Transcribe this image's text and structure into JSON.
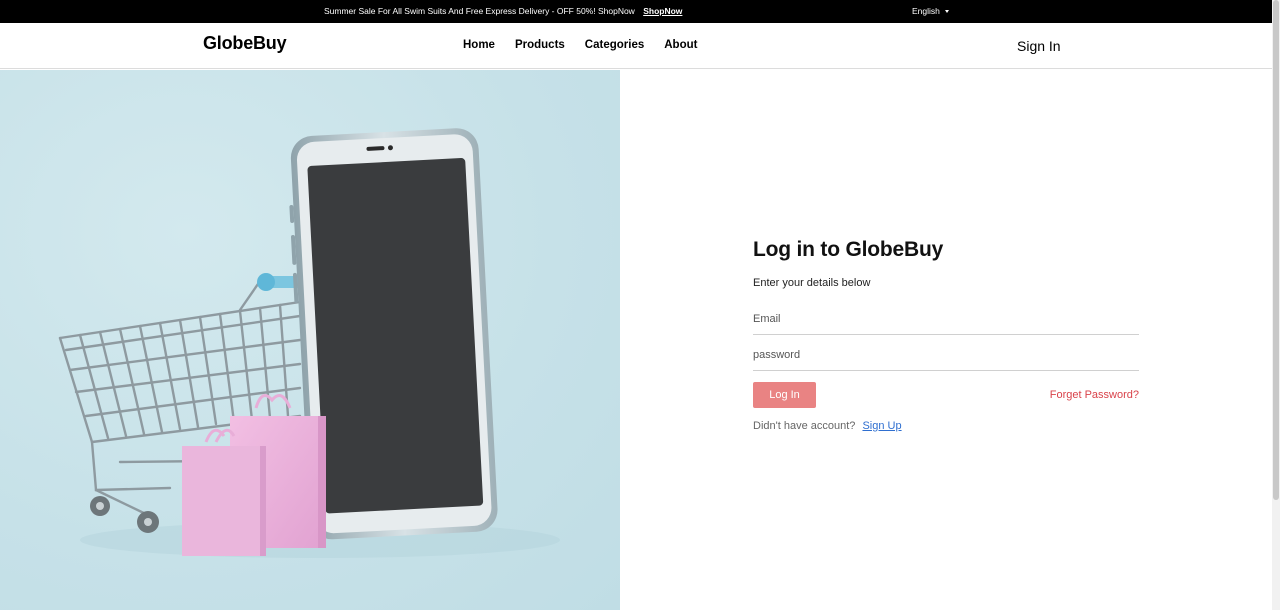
{
  "topbar": {
    "promo_text": "Summer Sale For All Swim Suits And Free Express Delivery - OFF 50%! ShopNow",
    "promo_link": "ShopNow",
    "language": "English"
  },
  "header": {
    "logo": "GlobeBuy",
    "nav": [
      "Home",
      "Products",
      "Categories",
      "About"
    ],
    "signin": "Sign In"
  },
  "hero": {
    "image_alt": "hero-shopping-cart-smartphone"
  },
  "form": {
    "title": "Log in to GlobeBuy",
    "subtitle": "Enter your details below",
    "email_placeholder": "Email",
    "password_placeholder": "password",
    "login_button": "Log In",
    "forgot_link": "Forget Password?",
    "signup_prompt": "Didn't have account?",
    "signup_link": "Sign Up"
  },
  "colors": {
    "accent_button": "#e98383",
    "forgot_link": "#d9424a",
    "signup_link": "#2f6fd0",
    "hero_bg": "#c6e1e8"
  }
}
